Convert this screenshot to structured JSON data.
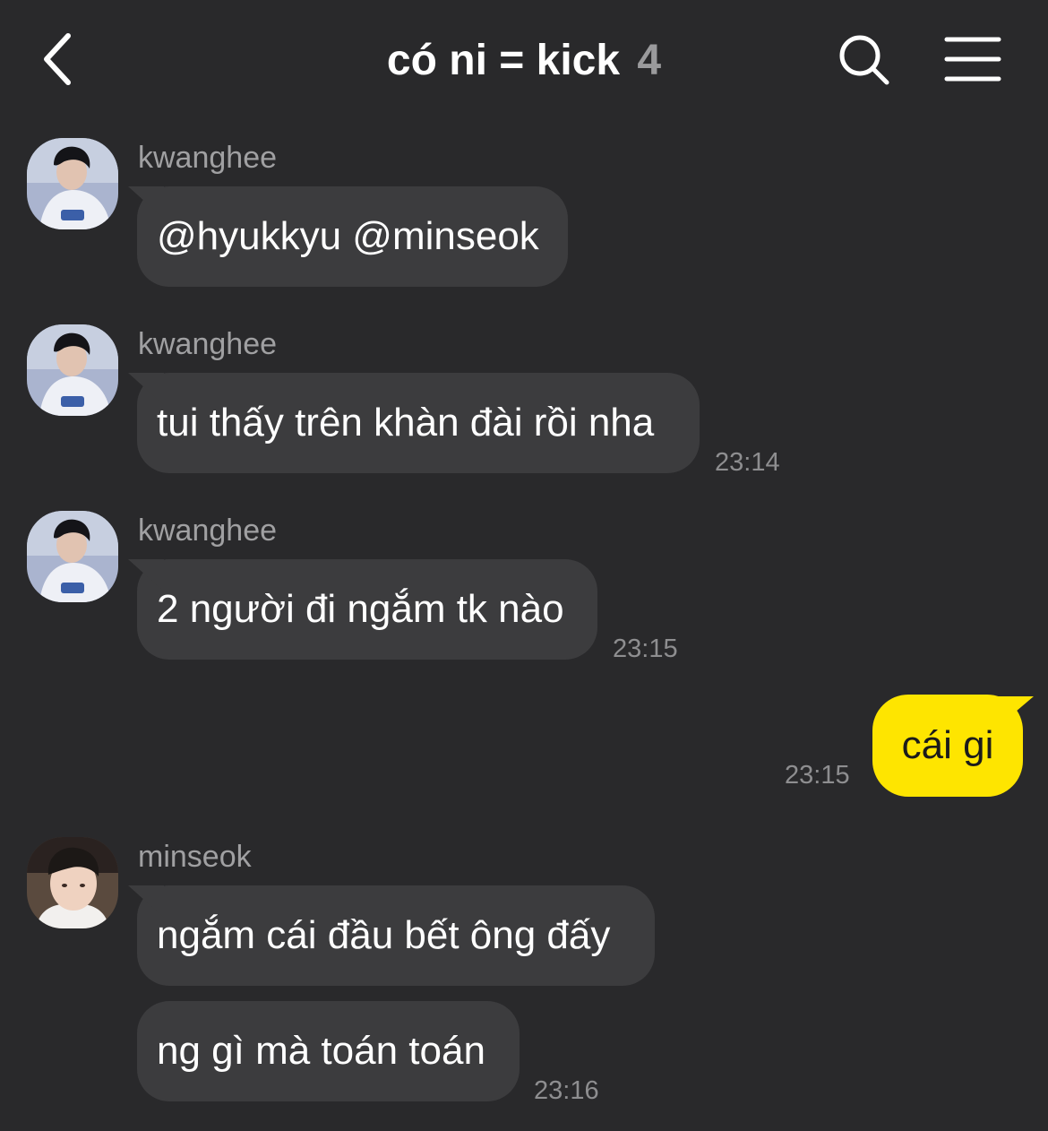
{
  "header": {
    "title": "có ni = kick",
    "member_count": "4",
    "back_icon": "chevron-left-icon",
    "search_icon": "search-icon",
    "menu_icon": "hamburger-menu-icon"
  },
  "colors": {
    "background": "#29292b",
    "bubble_other": "#3c3c3e",
    "bubble_mine": "#fee500",
    "sender_name": "#a0a0a2",
    "timestamp": "#8e8e90"
  },
  "messages": [
    {
      "sender": "kwanghee",
      "text": "@hyukkyu @minseok",
      "time": ""
    },
    {
      "sender": "kwanghee",
      "text": "tui thấy trên khàn đài rồi nha",
      "time": "23:14"
    },
    {
      "sender": "kwanghee",
      "text": "2 người đi ngắm tk nào",
      "time": "23:15"
    },
    {
      "sender": "me",
      "text": "cái gi",
      "time": "23:15"
    },
    {
      "sender": "minseok",
      "text": "ngắm cái đầu bết ông đấy",
      "time": ""
    },
    {
      "sender": "minseok",
      "text": "ng gì mà toán toán",
      "time": "23:16"
    }
  ]
}
